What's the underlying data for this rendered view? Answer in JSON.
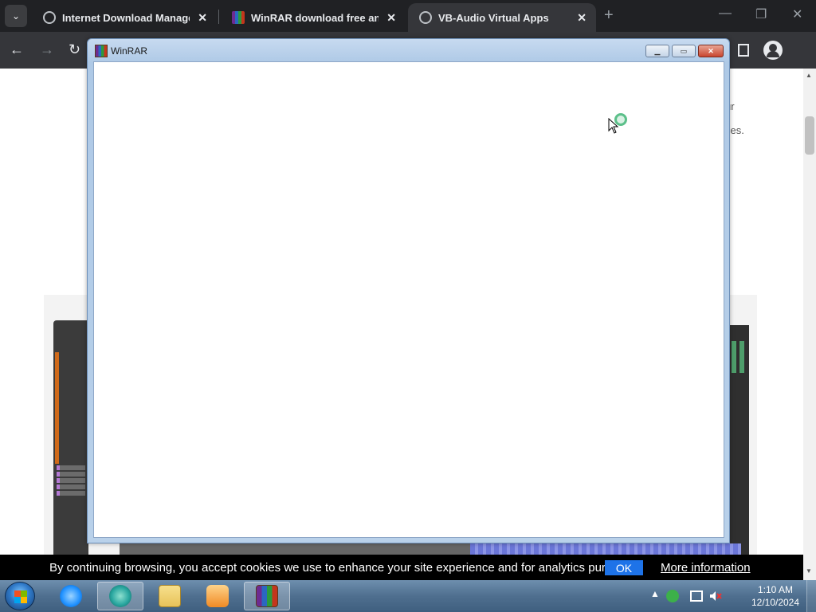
{
  "browser": {
    "tabs": [
      {
        "title": "Internet Download Manager is",
        "icon": "globe-icon",
        "active": false
      },
      {
        "title": "WinRAR download free and su",
        "icon": "winrar-icon",
        "active": false
      },
      {
        "title": "VB-Audio Virtual Apps",
        "icon": "globe-icon",
        "active": true
      }
    ],
    "close_glyph": "✕",
    "newtab_glyph": "+",
    "menu_glyph": "⌄",
    "back_glyph": "←",
    "forward_glyph": "→",
    "reload_glyph": "↻",
    "window_controls": {
      "minimize": "—",
      "restore": "❐",
      "close": "✕"
    }
  },
  "page": {
    "text_fragments": [
      "ur",
      "ces."
    ]
  },
  "winrar_dialog": {
    "title": "WinRAR",
    "buttons": {
      "minimize": "▁",
      "maximize": "▭",
      "close": "✕"
    }
  },
  "cookie_bar": {
    "message": "By continuing browsing, you accept cookies we use to enhance your site experience and for analytics purposes.",
    "ok_label": "OK",
    "more_label": "More information"
  },
  "taskbar": {
    "items": [
      {
        "name": "internet-explorer",
        "color": "#1e90ff"
      },
      {
        "name": "browser-app",
        "color": "#2aa7a0",
        "active": true
      },
      {
        "name": "file-explorer",
        "color": "#e7c25a"
      },
      {
        "name": "media-player",
        "color": "#f08a24"
      },
      {
        "name": "winrar",
        "color": "#8e3ba6",
        "active": true
      }
    ],
    "tray": {
      "up_arrow": "▲"
    },
    "clock": {
      "time": "1:10 AM",
      "date": "12/10/2024"
    }
  },
  "colors": {
    "browser_dark": "#202124",
    "toolbar": "#35363a",
    "cookie_ok": "#1e73e8",
    "taskbar": "#4f6f8f"
  }
}
